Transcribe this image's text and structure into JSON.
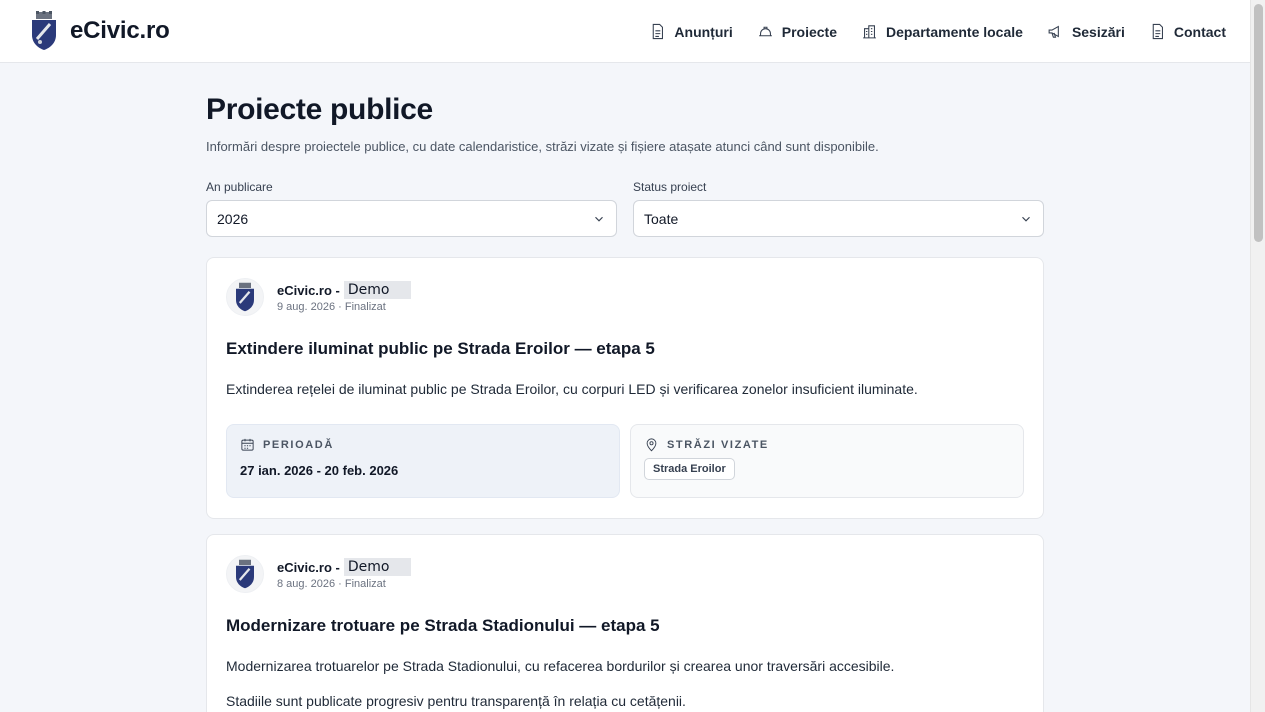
{
  "brand": {
    "name": "eCivic.ro"
  },
  "nav": [
    {
      "label": "Anunțuri",
      "icon": "document-icon"
    },
    {
      "label": "Proiecte",
      "icon": "helmet-icon"
    },
    {
      "label": "Departamente locale",
      "icon": "building-icon"
    },
    {
      "label": "Sesizări",
      "icon": "megaphone-icon"
    },
    {
      "label": "Contact",
      "icon": "document-icon"
    }
  ],
  "page": {
    "title": "Proiecte publice",
    "description": "Informări despre proiectele publice, cu date calendaristice, străzi vizate și fișiere atașate atunci când sunt disponibile."
  },
  "filters": {
    "year": {
      "label": "An publicare",
      "value": "2026"
    },
    "status": {
      "label": "Status proiect",
      "value": "Toate"
    }
  },
  "projects": [
    {
      "author": "eCivic.ro -",
      "author_tag": "Demo",
      "meta": "9 aug. 2026 · Finalizat",
      "title": "Extindere iluminat public pe Strada Eroilor — etapa 5",
      "text": "Extinderea rețelei de iluminat public pe Strada Eroilor, cu corpuri LED și verificarea zonelor insuficient iluminate.",
      "period_label": "PERIOADĂ",
      "period_value": "27 ian. 2026 - 20 feb. 2026",
      "streets_label": "STRĂZI VIZATE",
      "street": "Strada Eroilor"
    },
    {
      "author": "eCivic.ro -",
      "author_tag": "Demo",
      "meta": "8 aug. 2026 · Finalizat",
      "title": "Modernizare trotuare pe Strada Stadionului — etapa 5",
      "text": "Modernizarea trotuarelor pe Strada Stadionului, cu refacerea bordurilor și crearea unor traversări accesibile.",
      "text2": "Stadiile sunt publicate progresiv pentru transparență în relația cu cetățenii."
    }
  ],
  "colors": {
    "accent_logo": "#2b3a7a",
    "background": "#f4f6fa",
    "period_box": "#eef2f8"
  }
}
